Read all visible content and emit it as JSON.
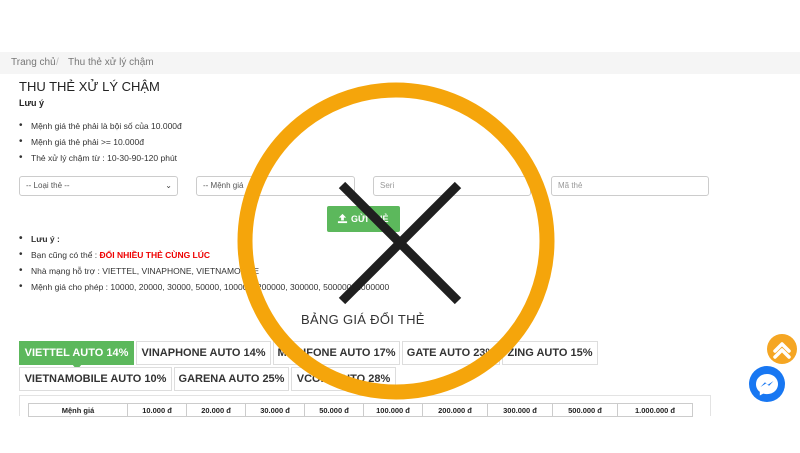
{
  "breadcrumb": {
    "home": "Trang chủ",
    "separator": "/",
    "current": "Thu thẻ xử lý chậm"
  },
  "page": {
    "title": "THU THẺ XỬ LÝ CHẬM",
    "note_label": "Lưu ý"
  },
  "rules": [
    "Mệnh giá thẻ phải là bội số của 10.000đ",
    "Mệnh giá thẻ phải >= 10.000đ",
    "Thẻ xử lý chậm từ : 10-30-90-120 phút"
  ],
  "form": {
    "card_type": "-- Loại thẻ --",
    "denomination": "-- Mệnh giá",
    "serial_placeholder": "Seri",
    "code_placeholder": "Mã thẻ",
    "submit_label": "GỬI THẺ"
  },
  "notes": {
    "label": "Lưu ý :",
    "multi_prefix": "Bạn cũng có thể : ",
    "multi_link": "ĐỔI NHIỀU THẺ CÙNG LÚC",
    "networks": "Nhà mạng hỗ trợ : VIETTEL, VINAPHONE, VIETNAMOBILE",
    "denominations": "Mệnh giá cho phép : 10000, 20000, 30000, 50000, 100000, 200000, 300000, 500000, 1000000"
  },
  "price_section": {
    "heading": "BẢNG GIÁ ĐỔI THẺ"
  },
  "tabs": [
    "VIETTEL AUTO 14%",
    "VINAPHONE AUTO 14%",
    "MOBIFONE AUTO 17%",
    "GATE AUTO 23%",
    "ZING AUTO 15%",
    "VIETNAMOBILE AUTO 10%",
    "GARENA AUTO 25%",
    "VCOIN AUTO 28%"
  ],
  "table": {
    "header": [
      "Mệnh giá",
      "10.000 đ",
      "20.000 đ",
      "30.000 đ",
      "50.000 đ",
      "100.000 đ",
      "200.000 đ",
      "300.000 đ",
      "500.000 đ",
      "1.000.000 đ"
    ]
  },
  "colors": {
    "accent_green": "#5cb85c",
    "overlay_orange": "#f5a50b",
    "cross": "#1f1f1f",
    "messenger_blue": "#1877f2",
    "alert_red": "#e00000"
  },
  "icons": {
    "submit": "upload-icon",
    "scroll_top": "chevron-up-icon",
    "chat": "messenger-icon"
  }
}
